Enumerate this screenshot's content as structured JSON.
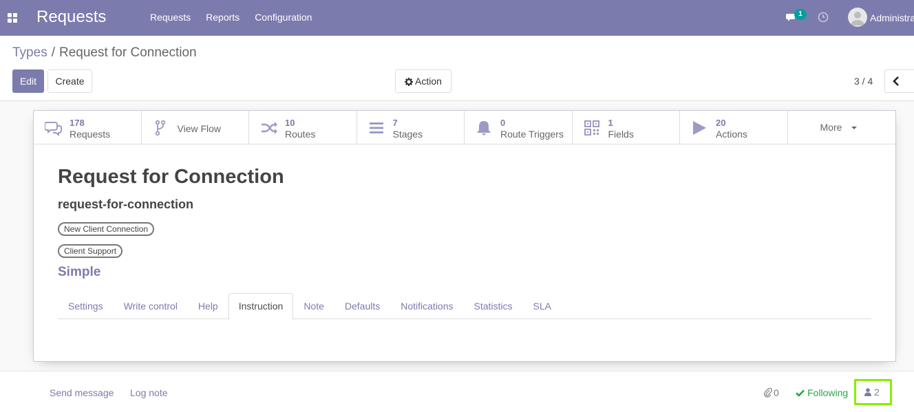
{
  "navbar": {
    "brand": "Requests",
    "menu": [
      "Requests",
      "Reports",
      "Configuration"
    ],
    "chat_count": "1",
    "user": "Administrator"
  },
  "breadcrumb": {
    "parent": "Types",
    "separator": "/",
    "current": "Request for Connection"
  },
  "toolbar": {
    "edit_label": "Edit",
    "create_label": "Create",
    "action_label": "Action",
    "pager": "3 / 4"
  },
  "stat_buttons": [
    {
      "value": "178",
      "label": "Requests",
      "icon": "comments-icon"
    },
    {
      "value": "",
      "label": "View Flow",
      "icon": "code-fork-icon"
    },
    {
      "value": "10",
      "label": "Routes",
      "icon": "random-icon"
    },
    {
      "value": "7",
      "label": "Stages",
      "icon": "bars-icon"
    },
    {
      "value": "0",
      "label": "Route Triggers",
      "icon": "bell-icon"
    },
    {
      "value": "1",
      "label": "Fields",
      "icon": "qrcode-icon"
    },
    {
      "value": "20",
      "label": "Actions",
      "icon": "play-icon"
    },
    {
      "value": "",
      "label": "More",
      "icon": "caret-down-icon"
    }
  ],
  "record": {
    "title": "Request for Connection",
    "code": "request-for-connection",
    "tags": [
      "New Client Connection",
      "Client Support"
    ],
    "kind": "Simple"
  },
  "tabs": {
    "items": [
      "Settings",
      "Write control",
      "Help",
      "Instruction",
      "Note",
      "Defaults",
      "Notifications",
      "Statistics",
      "SLA"
    ],
    "active": "Instruction"
  },
  "chatter": {
    "send_message": "Send message",
    "log_note": "Log note",
    "attachments": "0",
    "following": "Following",
    "followers": "2"
  },
  "colors": {
    "brand": "#7c7bad",
    "success": "#28a745",
    "highlight": "#87f000",
    "badge": "#00a09d"
  }
}
